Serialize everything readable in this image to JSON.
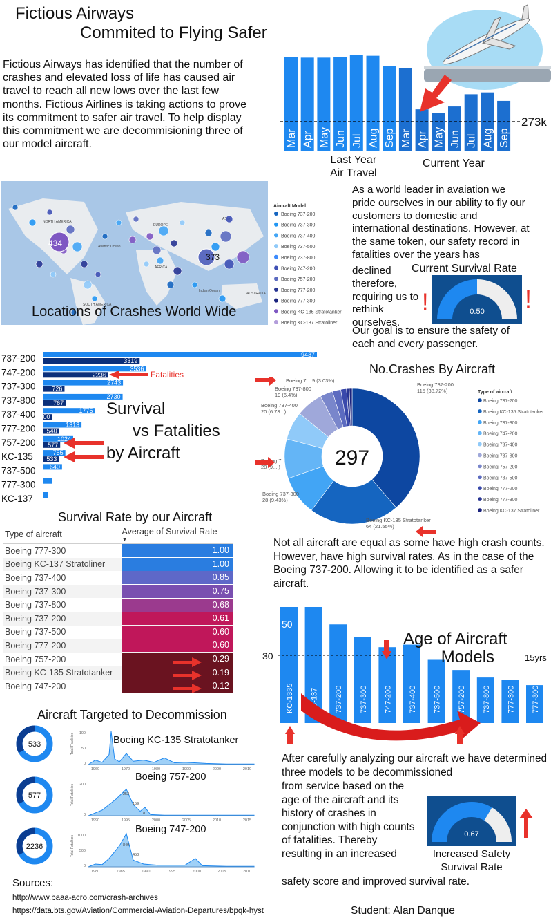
{
  "header": {
    "title_line1": "Fictious Airways",
    "title_line2": "Commited to Flying Safer"
  },
  "intro_text": "Fictious Airways has identified that the number of crashes and elevated loss of life has caused air travel to reach all new lows over the last few months. Fictious Airlines is taking actions to prove its commitment to safer air travel. To help display this commitment we are decommisioning three of our model aircraft.",
  "leader_text": {
    "part1": "As a world leader in avaiation we pride ourselves in our ability to fly our customers to domestic and international destinations. However, at the same token, our safety record in fatalities over the years has",
    "part2": "declined therefore, requiring us to rethink ourselves.",
    "part3": "Our goal is to ensure the safety of each and every passenger."
  },
  "colors": {
    "blue": "#1e88f0",
    "mid_blue": "#1c6fd0",
    "dark_blue": "#0b3d91",
    "navy": "#0c2d6b",
    "red": "#e8322b",
    "gauge_bg": "#0f4e8f"
  },
  "chart_data": [
    {
      "id": "air_travel",
      "type": "bar",
      "categories": [
        "Mar",
        "Apr",
        "May",
        "Jun",
        "Jul",
        "Aug",
        "Sep",
        "Mar",
        "Apr",
        "May",
        "Jun",
        "Jul",
        "Aug",
        "Sep"
      ],
      "values": [
        100,
        99,
        99,
        100,
        102,
        101,
        90,
        88,
        44,
        40,
        47,
        60,
        62,
        53
      ],
      "groups": [
        "Last Year Air Travel",
        "Current Year"
      ],
      "reference_label": "273k",
      "title": "",
      "xlabel": "",
      "ylabel": ""
    },
    {
      "id": "survival_vs_fatalities",
      "type": "bar",
      "orientation": "horizontal",
      "title": "Survival vs Fatalities by Aircraft",
      "categories": [
        "737-200",
        "747-200",
        "737-300",
        "737-800",
        "737-400",
        "777-200",
        "757-200",
        "KC-135",
        "737-500",
        "777-300",
        "KC-137"
      ],
      "series": [
        {
          "values": [
            9437,
            3536,
            2743,
            2730,
            1775,
            1313,
            1024,
            755,
            640,
            300,
            150
          ]
        },
        {
          "name": "Fatalities",
          "values": [
            3319,
            2236,
            726,
            767,
            300,
            540,
            577,
            533,
            0,
            0,
            0
          ]
        }
      ]
    },
    {
      "id": "crashes_by_aircraft",
      "type": "pie",
      "title": "No.Crashes By Aircraft",
      "total_label": "297",
      "legend_title": "Type of aircraft",
      "legend": [
        "Boeing 737-200",
        "Boeing KC-135 Stratotanker",
        "Boeing 737-300",
        "Boeing 747-200",
        "Boeing 737-400",
        "Boeing 737-800",
        "Boeing 757-200",
        "Boeing 737-500",
        "Boeing 777-200",
        "Boeing 777-300",
        "Boeing KC-137 Stratoliner"
      ],
      "values": [
        115,
        64,
        28,
        28,
        20,
        19,
        9,
        6,
        4,
        2,
        2
      ],
      "slice_labels": [
        "Boeing 737-200\n115 (38.72%)",
        "Boeing KC-135 Stratotanker\n64 (21.55%)",
        "Boeing 737-300\n28 (9.43%)",
        "Boeing 7...\n28 (9....)",
        "Boeing 737-400\n20 (6.73...)",
        "Boeing 737-800\n19 (6.4%)",
        "Boeing 7... 9 (3.03%)"
      ]
    },
    {
      "id": "survival_rate_table",
      "type": "table",
      "title": "Survival Rate by our Aircraft",
      "columns": [
        "Type of aircraft",
        "Average of Survival Rate"
      ],
      "rows": [
        [
          "Boeing 777-300",
          "1.00"
        ],
        [
          "Boeing KC-137 Stratoliner",
          "1.00"
        ],
        [
          "Boeing 737-400",
          "0.85"
        ],
        [
          "Boeing 737-300",
          "0.75"
        ],
        [
          "Boeing 737-800",
          "0.68"
        ],
        [
          "Boeing 737-200",
          "0.61"
        ],
        [
          "Boeing 737-500",
          "0.60"
        ],
        [
          "Boeing 777-200",
          "0.60"
        ],
        [
          "Boeing 757-200",
          "0.29"
        ],
        [
          "Boeing KC-135 Stratotanker",
          "0.19"
        ],
        [
          "Boeing 747-200",
          "0.12"
        ]
      ]
    },
    {
      "id": "aircraft_age",
      "type": "bar",
      "title": "Age of Aircraft Models",
      "categories": [
        "KC-1335",
        "KC-137",
        "737-200",
        "737-300",
        "747-200",
        "737-400",
        "737-500",
        "757-200",
        "737-800",
        "777-300",
        "777-300"
      ],
      "values": [
        50,
        47,
        39,
        34,
        30,
        31,
        25,
        21,
        18,
        17,
        15
      ],
      "value_labels": [
        "50",
        "",
        "",
        "",
        "",
        "",
        "",
        "",
        "",
        "",
        "15yrs"
      ],
      "reference_label": "30"
    },
    {
      "id": "current_survival_gauge",
      "type": "gauge",
      "title": "Current Survival Rate",
      "value": 0.5,
      "value_label": "0.50"
    },
    {
      "id": "increased_survival_gauge",
      "type": "gauge",
      "title": "Increased Safety Survival Rate",
      "value": 0.67,
      "value_label": "0.67"
    }
  ],
  "map": {
    "title": "Locations of Crashes World Wide",
    "labels": {
      "north_america": "NORTH AMERICA",
      "south_america": "SOUTH AMERICA",
      "europe": "EUROPE",
      "asia": "ASIA",
      "africa": "AFRICA",
      "australia": "AUSTRALIA",
      "indian_ocean": "Indian Ocean",
      "atlantic": "Atlantic Ocean"
    },
    "bubble_labels": [
      "434",
      "373"
    ],
    "legend_title": "Aircraft Model",
    "legend": [
      "Boeing 737-200",
      "Boeing 737-300",
      "Boeing 737-400",
      "Boeing 737-500",
      "Boeing 737-800",
      "Boeing 747-200",
      "Boeing 757-200",
      "Boeing 777-200",
      "Boeing 777-300",
      "Boeing KC-135 Stratotanker",
      "Boeing KC-137 Stratoliner"
    ],
    "legend_colors": [
      "#1565c0",
      "#2196f3",
      "#42a5f5",
      "#90caf9",
      "#3d8bfd",
      "#3f51b5",
      "#5c6bc0",
      "#283593",
      "#1a237e",
      "#7e57c2",
      "#b39ddb"
    ]
  },
  "air_travel_labels": {
    "last_year": "Last Year Air Travel",
    "last_year_l1": "Last Year",
    "last_year_l2": "Air Travel",
    "current": "Current Year"
  },
  "decommission": {
    "title": "Aircraft Targeted to Decommission",
    "items": [
      {
        "label": "Boeing KC-135 Stratotanker",
        "donut": "533",
        "years": [
          "1960",
          "1970",
          "1980",
          "1990",
          "2000",
          "2010"
        ],
        "yticks": [
          "100",
          "50",
          "0"
        ],
        "ylabel": "Total Fatalities"
      },
      {
        "label": "Boeing 757-200",
        "donut": "577",
        "years": [
          "1990",
          "1995",
          "2000",
          "2005",
          "2010",
          "2015"
        ],
        "yticks": [
          "200",
          "0"
        ],
        "ylabel": "Total Fatalities",
        "peak_labels": [
          "252",
          "159",
          "70"
        ]
      },
      {
        "label": "Boeing 747-200",
        "donut": "2236",
        "years": [
          "1980",
          "1985",
          "1990",
          "1995",
          "2000",
          "2005",
          "2010"
        ],
        "yticks": [
          "1000",
          "500",
          "0"
        ],
        "ylabel": "Total Fatalities",
        "peak_labels": [
          "849",
          "450"
        ]
      }
    ]
  },
  "not_all_text": "Not all aircraft are equal as some have high crash counts. However, have high survival rates. As in the case of the Boeing 737-200. Allowing it to be identified as a safer aircraft.",
  "after_text": {
    "part1": "After carefully analyzing our aircraft we have determined three models to be decommissioned",
    "part2": "from service based on the age of the aircraft and its history of crashes in conjunction with high counts of fatalities. Thereby resulting in an increased",
    "part3": "safety score and improved survival rate."
  },
  "sources": {
    "label": "Sources:",
    "url1": "http://www.baaa-acro.com/crash-archives",
    "url2": "https://data.bts.gov/Aviation/Commercial-Aviation-Departures/bpqk-hyst"
  },
  "student": "Student: Alan Danque"
}
